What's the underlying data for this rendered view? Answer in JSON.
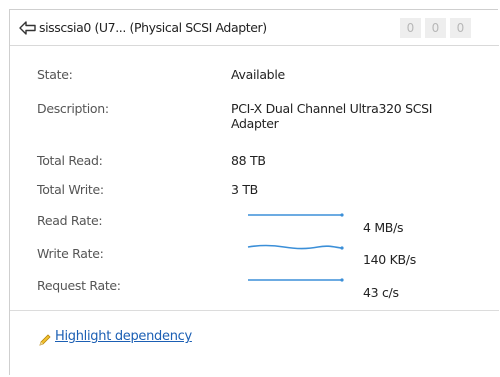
{
  "header": {
    "icon": "back-arrow-icon",
    "title": "sisscsia0 (U7... (Physical SCSI Adapter)",
    "badges": [
      "0",
      "0",
      "0"
    ]
  },
  "details": [
    {
      "label": "State:",
      "value": "Available"
    },
    {
      "label": "Description:",
      "value": "PCI-X Dual Channel Ultra320 SCSI Adapter"
    },
    {
      "label": "Total Read:",
      "value": "88 TB"
    },
    {
      "label": "Total Write:",
      "value": "3 TB"
    }
  ],
  "rates": [
    {
      "label": "Read Rate:",
      "value": "4 MB/s"
    },
    {
      "label": "Write Rate:",
      "value": "140 KB/s"
    },
    {
      "label": "Request Rate:",
      "value": "43 c/s"
    }
  ],
  "footer": {
    "link_icon": "pencil-highlight-icon",
    "link_label": "Highlight dependency"
  },
  "colors": {
    "sparkline": "#3b8fd8",
    "link": "#1b5fb4",
    "badge_bg": "#eeeeee",
    "badge_text": "#b8b8b8"
  }
}
